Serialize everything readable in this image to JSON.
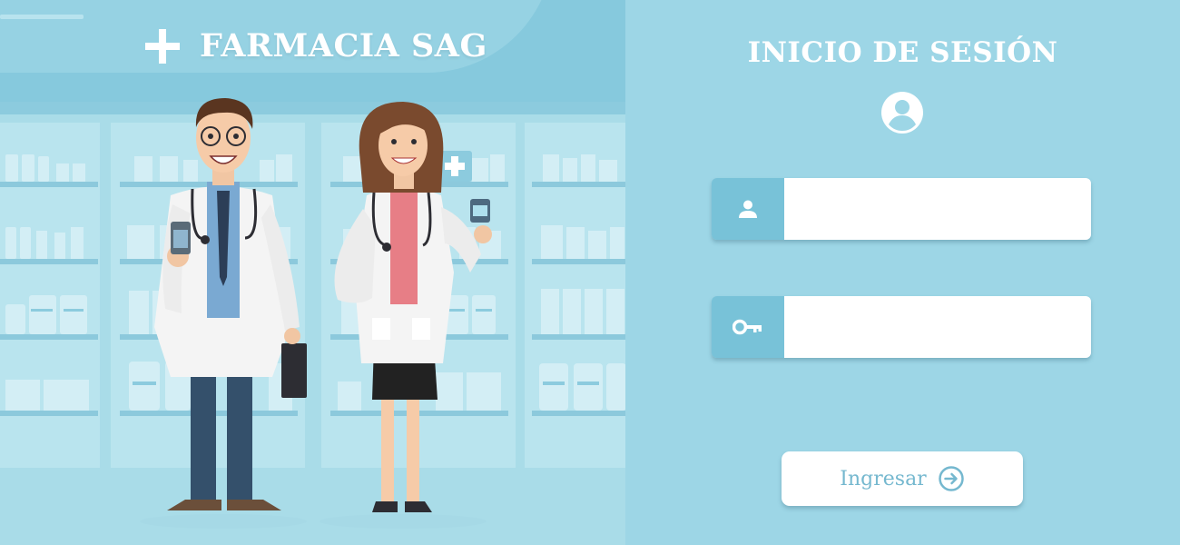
{
  "brand": {
    "name": "FARMACIA SAG",
    "icon": "cross-icon"
  },
  "illustration": {
    "subject": "pharmacists-illustration"
  },
  "login": {
    "title": "INICIO DE SESIÓN",
    "avatar_icon": "account-circle-icon",
    "username": {
      "icon": "user-icon",
      "value": "",
      "placeholder": ""
    },
    "password": {
      "icon": "key-icon",
      "value": "",
      "placeholder": ""
    },
    "submit_label": "Ingresar",
    "submit_icon": "arrow-right-circle-icon"
  },
  "colors": {
    "accent": "#78c2d8",
    "panel_background": "#9dd6e6",
    "header_background": "#86c9dd",
    "button_text": "#75b8cf"
  }
}
